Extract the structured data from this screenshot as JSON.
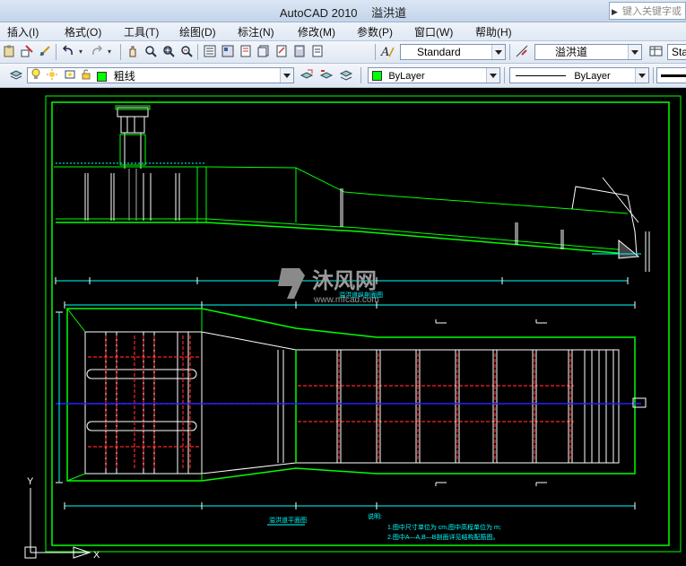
{
  "titlebar": {
    "app_name": "AutoCAD 2010",
    "file_name": "溢洪道",
    "search_placeholder": "键入关键字或"
  },
  "menu": {
    "items": [
      "插入(I)",
      "格式(O)",
      "工具(T)",
      "绘图(D)",
      "标注(N)",
      "修改(M)",
      "参数(P)",
      "窗口(W)",
      "帮助(H)"
    ]
  },
  "toolbar1": {
    "text_style": "Standard",
    "dim_style": "溢洪道",
    "table_style_partial": "Sta"
  },
  "toolbar2": {
    "layer": "粗线",
    "color": "ByLayer",
    "linetype": "ByLayer",
    "layer_color": "#00ff00",
    "color_swatch": "#00ff00"
  },
  "drawing": {
    "section_label": "溢洪道纵剖面图",
    "plan_label": "溢洪道平面图",
    "notes_title": "说明:",
    "note_1": "1.图中尺寸单位为 cm,图中高程单位为 m;",
    "note_2": "2.图中A—A,B—B剖面详见结构配筋图。",
    "watermark_text": "沐风网",
    "watermark_url": "www.mfcad.com",
    "ucs_y_label": "Y",
    "ucs_x_label": "X",
    "colors": {
      "frame": "#00ff00",
      "outline": "#ffffff",
      "centerline": "#2222ff",
      "hidden": "#ff2222",
      "dim": "#00ffff"
    }
  }
}
